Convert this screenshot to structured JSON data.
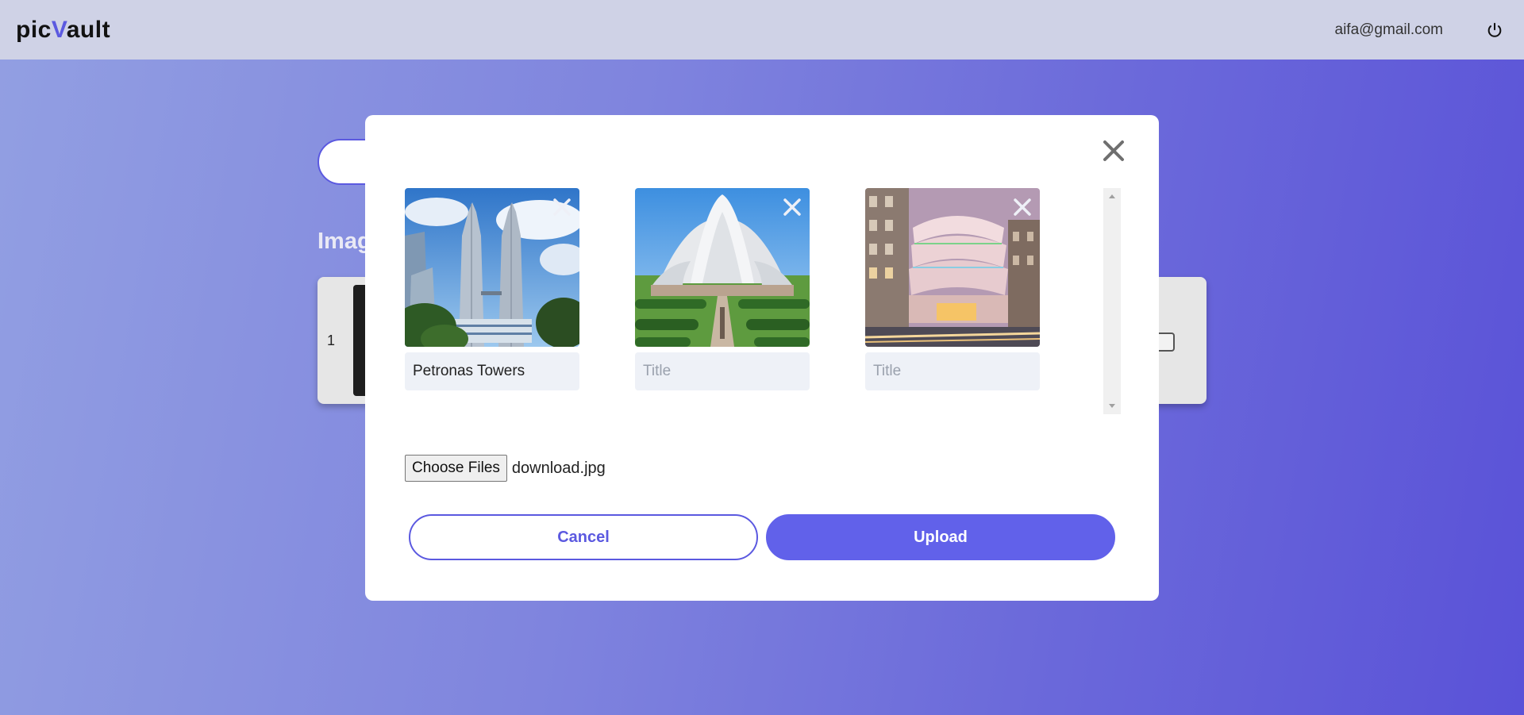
{
  "header": {
    "logo_prefix": "pic",
    "logo_v": "V",
    "logo_suffix": "ault",
    "user_email": "aifa@gmail.com",
    "logout_icon": "power-icon"
  },
  "background": {
    "heading": "Imag",
    "row_number": "1"
  },
  "modal": {
    "close_icon": "close-icon",
    "images": [
      {
        "alt": "Petronas Towers",
        "title_value": "Petronas Towers",
        "title_placeholder": "Title"
      },
      {
        "alt": "Lotus Temple",
        "title_value": "",
        "title_placeholder": "Title"
      },
      {
        "alt": "Guggenheim Museum",
        "title_value": "",
        "title_placeholder": "Title"
      }
    ],
    "file_button_label": "Choose Files",
    "file_name": "download.jpg",
    "cancel_label": "Cancel",
    "upload_label": "Upload"
  },
  "colors": {
    "accent": "#5b59e0",
    "upload_bg": "#6161ea",
    "header_bg": "#cfd2e6"
  }
}
